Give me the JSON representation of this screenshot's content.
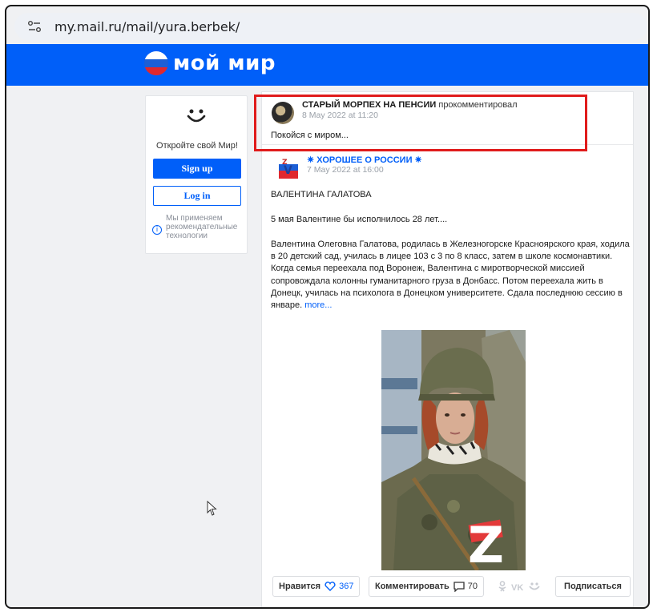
{
  "browser": {
    "url": "my.mail.ru/mail/yura.berbek/"
  },
  "header": {
    "logo_text": "мой мир",
    "brand_color": "#005ff9"
  },
  "sidebar": {
    "title": "Откройте свой Мир!",
    "signup_label": "Sign up",
    "login_label": "Log in",
    "info_text": "Мы применяем рекомендательные технологии"
  },
  "comment": {
    "author": "СТАРЫЙ МОРПЕХ НА ПЕНСИИ",
    "action": "прокомментировал",
    "date": "8 May 2022 at 11:20",
    "text": "Покойся с миром..."
  },
  "post": {
    "group_name": "✷ ХОРОШЕЕ О РОССИИ ✷",
    "date": "7 May 2022 at 16:00",
    "title": "ВАЛЕНТИНА ГАЛАТОВА",
    "line1": "5 мая Валентине бы исполнилось 28 лет....",
    "body": "Валентина Олеговна Галатова, родилась в Железногорске Красноярского края, ходила в 20 детский сад, училась в лицее 103 с 3 по 8 класс, затем в школе космонавтики.\nКогда семья переехала под Воронеж, Валентина с миротворческой миссией сопровождала колонны гуманитарного груза в Донбасс. Потом переехала жить в Донецк, училась на психолога в Донецком университете. Сдала последнюю сессию в январе.",
    "more_label": "more...",
    "photo_mark": "Z"
  },
  "actions": {
    "like_label": "Нравится",
    "like_count": "367",
    "comment_label": "Комментировать",
    "comment_count": "70",
    "subscribe_label": "Подписаться"
  },
  "share_icons": [
    "odnoklassniki-icon",
    "vk-icon",
    "mymir-icon"
  ],
  "share_labels": {
    "vk": "VK"
  },
  "highlight_color": "#e01b1b"
}
